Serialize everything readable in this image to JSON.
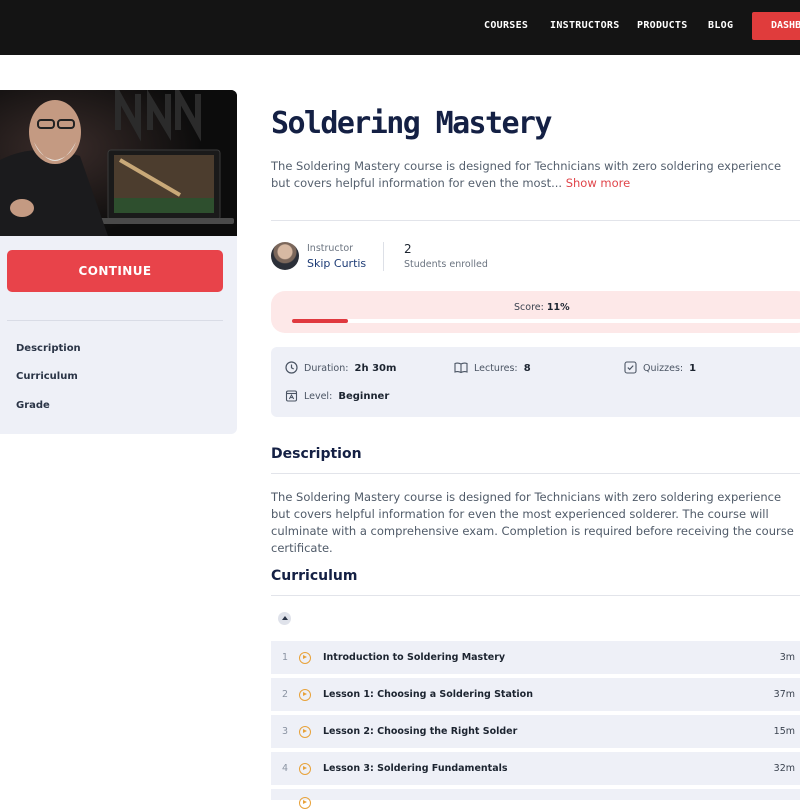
{
  "nav": {
    "links": [
      "COURSES",
      "INSTRUCTORS",
      "PRODUCTS",
      "BLOG"
    ],
    "dashboard_label": "DASHBOARD"
  },
  "sidebar": {
    "continue_label": "CONTINUE",
    "items": [
      "Description",
      "Curriculum",
      "Grade"
    ]
  },
  "course": {
    "title": "Soldering Mastery",
    "intro": "The Soldering Mastery course is designed for Technicians with zero soldering experience but covers helpful information for even the most...",
    "show_more": "Show more",
    "instructor_label": "Instructor",
    "instructor_name": "Skip Curtis",
    "enrolled_count": "2",
    "enrolled_label": "Students enrolled",
    "score_label": "Score:",
    "score_value": "11%",
    "score_fraction": 0.11,
    "duration_label": "Duration:",
    "duration_value": "2h 30m",
    "lectures_label": "Lectures:",
    "lectures_value": "8",
    "quizzes_label": "Quizzes:",
    "quizzes_value": "1",
    "level_label": "Level:",
    "level_value": "Beginner"
  },
  "description": {
    "heading": "Description",
    "text": "The Soldering Mastery course is designed for Technicians with zero soldering experience but covers helpful information for even the most experienced solderer. The course will culminate with a comprehensive exam. Completion is required before receiving the course certificate."
  },
  "curriculum": {
    "heading": "Curriculum",
    "lessons": [
      {
        "num": "1",
        "title": "Introduction to Soldering Mastery",
        "duration": "3m"
      },
      {
        "num": "2",
        "title": "Lesson 1: Choosing a Soldering Station",
        "duration": "37m"
      },
      {
        "num": "3",
        "title": "Lesson 2: Choosing the Right Solder",
        "duration": "15m"
      },
      {
        "num": "4",
        "title": "Lesson 3: Soldering Fundamentals",
        "duration": "32m"
      }
    ]
  },
  "colors": {
    "accent": "#e8434a",
    "nav_bg": "#141414",
    "panel_bg": "#eef0f7",
    "score_bg": "#fde8e8",
    "play_icon": "#e8a23a"
  }
}
